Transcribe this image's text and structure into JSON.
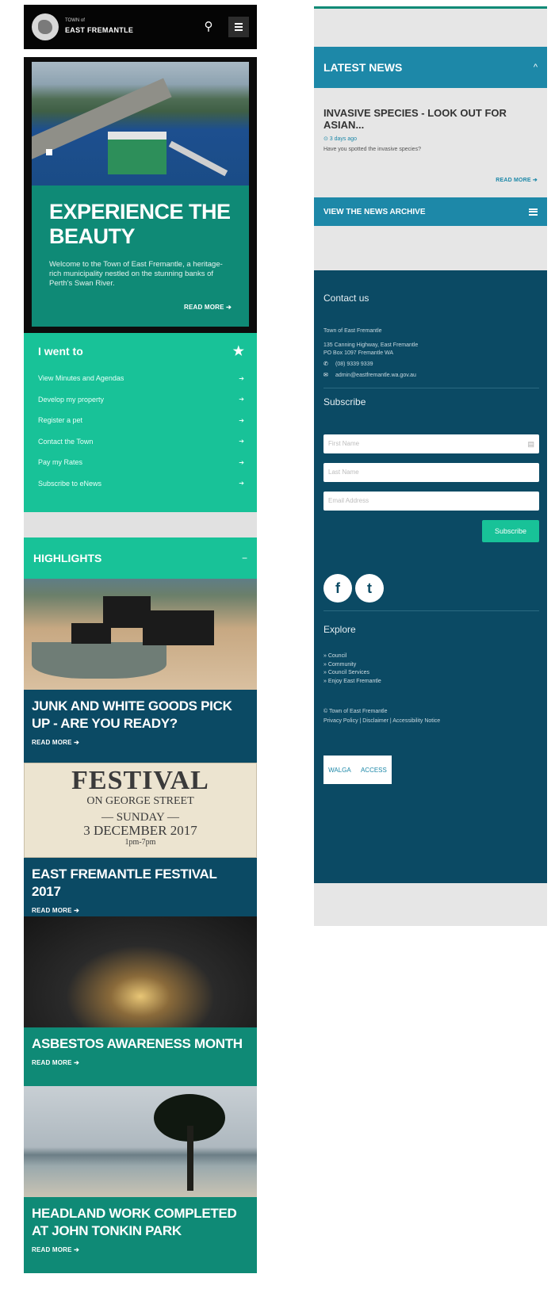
{
  "header": {
    "logo_small": "TOWN of",
    "logo_name": "EAST FREMANTLE"
  },
  "hero": {
    "title": "EXPERIENCE THE BEAUTY",
    "text": "Welcome to the Town of East Fremantle, a heritage-rich municipality nestled on the stunning banks of Perth's Swan River.",
    "read_more": "READ MORE ➔"
  },
  "i_went_to": {
    "heading": "I went to",
    "items": [
      {
        "label": "View Minutes and Agendas"
      },
      {
        "label": "Develop my property"
      },
      {
        "label": "Register a pet"
      },
      {
        "label": "Contact the Town"
      },
      {
        "label": "Pay my Rates"
      },
      {
        "label": "Subscribe to eNews"
      }
    ]
  },
  "highlights": {
    "heading": "HIGHLIGHTS",
    "toggle": "−",
    "cards": [
      {
        "title": "JUNK AND WHITE GOODS PICK UP - ARE YOU READY?",
        "read_more": "READ MORE ➔"
      },
      {
        "title": "EAST FREMANTLE FESTIVAL 2017",
        "read_more": "READ MORE ➔"
      },
      {
        "title": "ASBESTOS AWARENESS MONTH",
        "read_more": "READ MORE ➔"
      },
      {
        "title": "HEADLAND WORK COMPLETED AT JOHN TONKIN PARK",
        "read_more": "READ MORE ➔"
      }
    ],
    "festival_poster": {
      "line1": "FESTIVAL",
      "line2": "ON GEORGE STREET",
      "line3": "— SUNDAY —",
      "line4": "3 DECEMBER 2017",
      "line5": "1pm-7pm"
    }
  },
  "news": {
    "heading": "LATEST NEWS",
    "toggle": "^",
    "item_title": "INVASIVE SPECIES - LOOK OUT FOR ASIAN...",
    "item_time": "⊙ 3 days ago",
    "item_excerpt": "Have you spotted the invasive species?",
    "read_more": "READ MORE ➔",
    "archive": "VIEW THE NEWS ARCHIVE"
  },
  "footer": {
    "contact_heading": "Contact us",
    "org": "Town of East Fremantle",
    "addr1": "135 Canning Highway, East Fremantle",
    "addr2": "PO Box 1097 Fremantle WA",
    "phone": "(08) 9339 9339",
    "email": "admin@eastfremantle.wa.gov.au",
    "subscribe_heading": "Subscribe",
    "first_name_ph": "First Name",
    "last_name_ph": "Last Name",
    "email_ph": "Email Address",
    "subscribe_button": "Subscribe",
    "explore_heading": "Explore",
    "explore_items": [
      "» Council",
      "» Community",
      "» Council Services",
      "» Enjoy East Fremantle"
    ],
    "copyright": "© Town of East Fremantle",
    "legal": "Privacy Policy | Disclaimer | Accessibility Notice",
    "badge_left": "WALGA",
    "badge_right": "ACCESS"
  }
}
